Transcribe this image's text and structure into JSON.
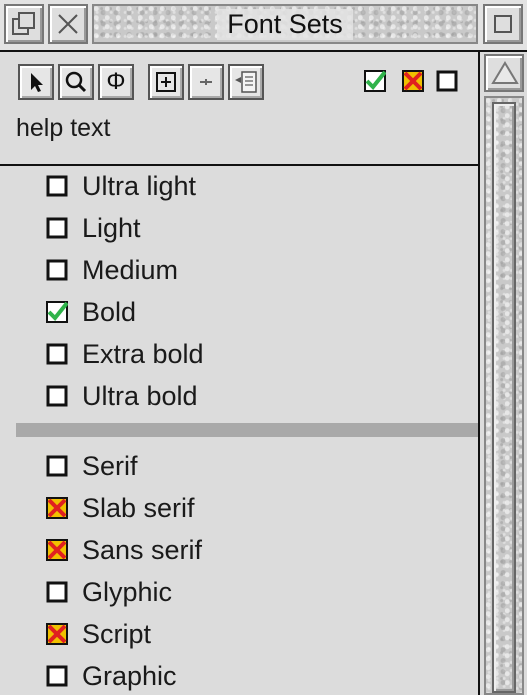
{
  "window": {
    "title": "Font Sets"
  },
  "toolbar": {
    "help_text": "help text"
  },
  "weights": [
    {
      "label": "Ultra light",
      "state": "off"
    },
    {
      "label": "Light",
      "state": "off"
    },
    {
      "label": "Medium",
      "state": "off"
    },
    {
      "label": "Bold",
      "state": "on"
    },
    {
      "label": "Extra bold",
      "state": "off"
    },
    {
      "label": "Ultra bold",
      "state": "off"
    }
  ],
  "styles": [
    {
      "label": "Serif",
      "state": "off"
    },
    {
      "label": "Slab serif",
      "state": "excluded"
    },
    {
      "label": "Sans serif",
      "state": "excluded"
    },
    {
      "label": "Glyphic",
      "state": "off"
    },
    {
      "label": "Script",
      "state": "excluded"
    },
    {
      "label": "Graphic",
      "state": "off"
    }
  ],
  "colors": {
    "tick": "#2fb34a",
    "cross": "#e02020",
    "box_border": "#111111"
  }
}
